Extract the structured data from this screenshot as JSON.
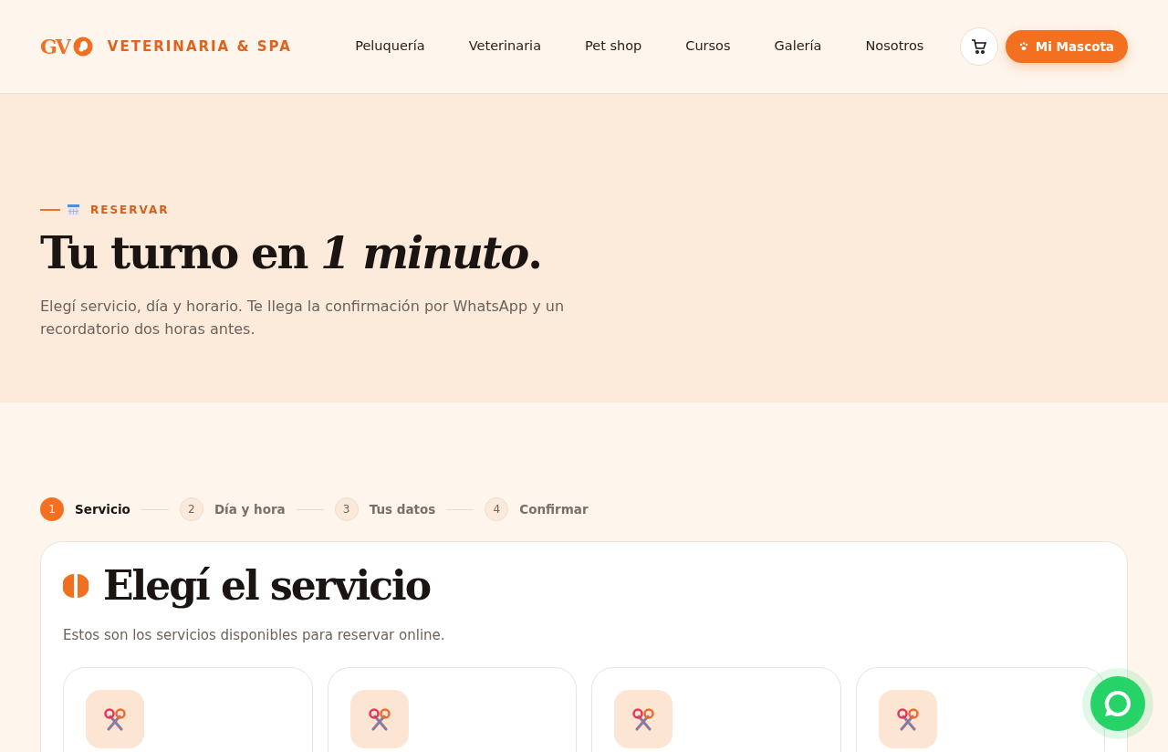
{
  "header": {
    "logo_text": "GV",
    "brand": "VETERINARIA & SPA",
    "nav": [
      {
        "label": "Peluquería"
      },
      {
        "label": "Veterinaria"
      },
      {
        "label": "Pet shop"
      },
      {
        "label": "Cursos"
      },
      {
        "label": "Galería"
      },
      {
        "label": "Nosotros"
      }
    ],
    "account_button": "Mi Mascota"
  },
  "hero": {
    "eyebrow": "RESERVAR",
    "title": "Tu turno en *1 minuto*.",
    "lead": "Elegí servicio, día y horario. Te llega la confirmación por WhatsApp y un recordatorio dos horas antes."
  },
  "steps": [
    {
      "number": "1",
      "label": "Servicio",
      "selected": true
    },
    {
      "number": "2",
      "label": "Día y hora",
      "selected": false
    },
    {
      "number": "3",
      "label": "Tus datos",
      "selected": false
    },
    {
      "number": "4",
      "label": "Confirmar",
      "selected": false
    }
  ],
  "panel": {
    "title": "Elegí el servicio",
    "subtitle": "Estos son los servicios disponibles para reservar online.",
    "service_cards": [
      {
        "kind": "grooming"
      },
      {
        "kind": "grooming"
      },
      {
        "kind": "grooming"
      },
      {
        "kind": "grooming"
      }
    ]
  }
}
